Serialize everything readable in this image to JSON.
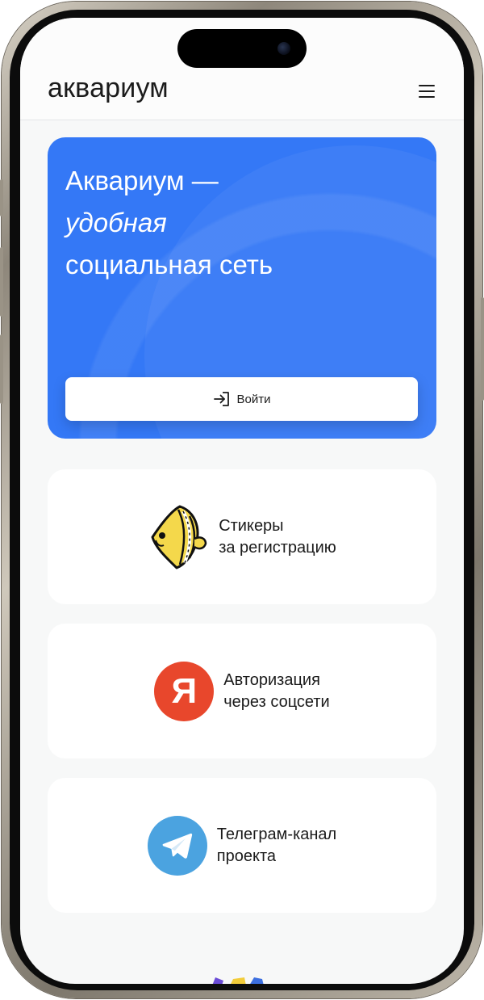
{
  "header": {
    "brand": "аквариум",
    "menu_icon": "hamburger-menu-icon"
  },
  "hero": {
    "title_line1": "Аквариум —",
    "title_line2": "удобная",
    "title_line3": "социальная сеть",
    "login_label": "Войти",
    "login_icon": "login-arrow-icon",
    "background_color": "#3478f6"
  },
  "features": [
    {
      "line1": "Стикеры",
      "line2": "за регистрацию",
      "icon": "fish-sticker-icon"
    },
    {
      "line1": "Авторизация",
      "line2": "через соцсети",
      "icon": "yandex-logo-icon",
      "logo_letter": "Я",
      "logo_color": "#e8472c"
    },
    {
      "line1": "Телеграм-канал",
      "line2": "проекта",
      "icon": "telegram-logo-icon",
      "logo_color": "#4ba3e0"
    }
  ]
}
